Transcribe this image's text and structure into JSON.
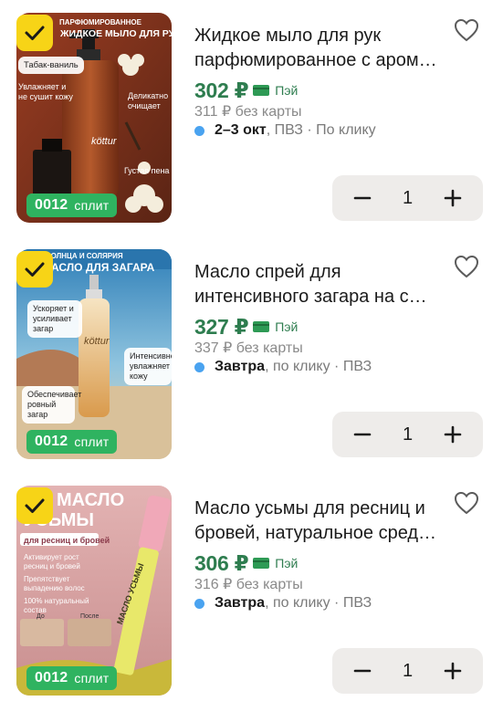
{
  "currency": "₽",
  "colors": {
    "check_badge": "#f7d417",
    "split_badge": "#2fb360",
    "price": "#2e7d4f",
    "delivery_dot": "#4aa3f0",
    "stepper_bg": "#eeecea"
  },
  "icons": [
    "check-icon",
    "heart-icon",
    "minus-icon",
    "plus-icon",
    "card-icon",
    "delivery-dot-icon"
  ],
  "items": [
    {
      "title_line1": "Жидкое мыло для рук",
      "title_line2": "парфюмированное с аром…",
      "price": "302 ₽",
      "pay_label": "Пэй",
      "old_price": "311 ₽ без карты",
      "delivery_bold": "2–3 окт",
      "delivery_rest": ", ПВЗ · По клику",
      "qty": "1",
      "split_amount": "0012",
      "split_label": "сплит",
      "image": {
        "promo_top": "ПАРФЮМИРОВАННОЕ",
        "promo_main": "ЖИДКОЕ МЫЛО ДЛЯ РУК",
        "brand": "köttur",
        "chips": [
          "Табак-ваниль",
          "Увлажняет и не сушит кожу",
          "Деликатно очищает",
          "Густая пена"
        ]
      }
    },
    {
      "title_line1": "Масло спрей для",
      "title_line2": "интенсивного загара на с…",
      "price": "327 ₽",
      "pay_label": "Пэй",
      "old_price": "337 ₽ без карты",
      "delivery_bold": "Завтра",
      "delivery_rest": ", по клику · ПВЗ",
      "qty": "1",
      "split_amount": "0012",
      "split_label": "сплит",
      "image": {
        "promo_top": "СОЛНЦА И СОЛЯРИЯ",
        "promo_main": "МАСЛО ДЛЯ ЗАГАРА",
        "brand": "köttur",
        "chips": [
          "Ускоряет и усиливает загар",
          "Интенсивно увлажняет кожу",
          "Обеспечивает ровный загар"
        ]
      }
    },
    {
      "title_line1": "Масло усьмы для ресниц и",
      "title_line2": "бровей, натуральное сред…",
      "price": "306 ₽",
      "pay_label": "Пэй",
      "old_price": "316 ₽ без карты",
      "delivery_bold": "Завтра",
      "delivery_rest": ", по клику · ПВЗ",
      "qty": "1",
      "split_amount": "0012",
      "split_label": "сплит",
      "image": {
        "promo_main_1": "МАСЛО",
        "promo_main_2": "УСЬМЫ",
        "subtitle": "для ресниц и бровей",
        "bullets": [
          "Активирует рост ресниц и бровей",
          "Препятствует выпадению волос",
          "100% натуральный состав"
        ],
        "before": "До",
        "after": "После",
        "bottle_text": "МАСЛО УСЬМЫ"
      }
    }
  ]
}
